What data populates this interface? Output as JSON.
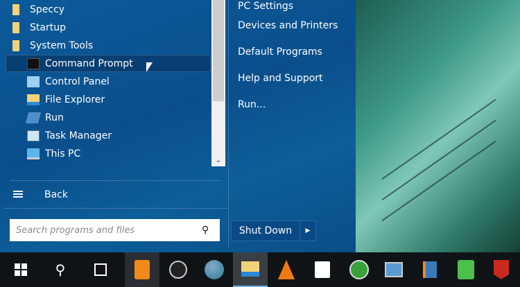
{
  "programs": [
    {
      "label": "Speccy",
      "icon": "folder-icon"
    },
    {
      "label": "Startup",
      "icon": "folder-icon"
    },
    {
      "label": "System Tools",
      "icon": "folder-icon"
    },
    {
      "label": "Command Prompt",
      "icon": "command-prompt-icon",
      "selected": true
    },
    {
      "label": "Control Panel",
      "icon": "control-panel-icon"
    },
    {
      "label": "File Explorer",
      "icon": "file-explorer-icon"
    },
    {
      "label": "Run",
      "icon": "run-icon"
    },
    {
      "label": "Task Manager",
      "icon": "task-manager-icon"
    },
    {
      "label": "This PC",
      "icon": "this-pc-icon"
    }
  ],
  "back_label": "Back",
  "search": {
    "placeholder": "Search programs and files"
  },
  "right_items": [
    "PC Settings",
    "Devices and Printers",
    "Default Programs",
    "Help and Support",
    "Run..."
  ],
  "shutdown_label": "Shut Down",
  "taskbar": [
    "start",
    "search",
    "task-view",
    "clock-app",
    "obs",
    "earth",
    "file-explorer",
    "vlc",
    "store",
    "green-app",
    "network-app",
    "media-player",
    "sheets",
    "mcafee"
  ]
}
